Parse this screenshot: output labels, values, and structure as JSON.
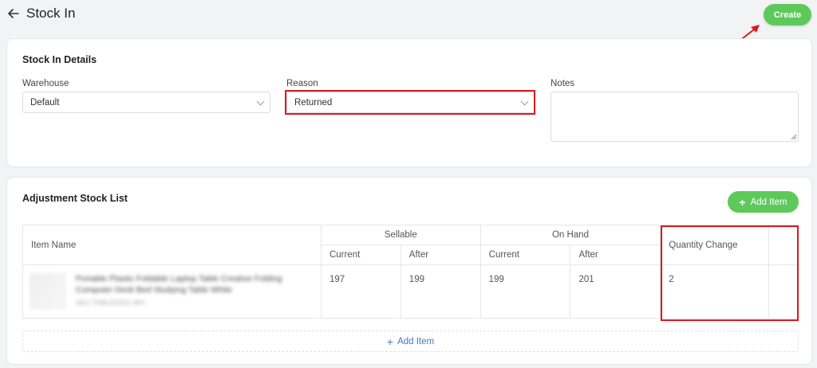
{
  "header": {
    "back_icon": "arrow-left-icon",
    "title": "Stock In",
    "create_label": "Create"
  },
  "details": {
    "title": "Stock In Details",
    "warehouse": {
      "label": "Warehouse",
      "value": "Default"
    },
    "reason": {
      "label": "Reason",
      "value": "Returned"
    },
    "notes": {
      "label": "Notes",
      "value": ""
    }
  },
  "adjustment": {
    "title": "Adjustment Stock List",
    "add_item_label": "Add Item",
    "columns": {
      "item_name": "Item Name",
      "sellable": "Sellable",
      "on_hand": "On Hand",
      "current": "Current",
      "after": "After",
      "quantity_change": "Quantity Change"
    },
    "rows": [
      {
        "product_name": "Portable Plastic Foldable Laptop Table Creative Folding Computer Desk Bed Studying Table White",
        "product_sku": "SKU TABLE0001-WH",
        "sellable_current": "197",
        "sellable_after": "199",
        "onhand_current": "199",
        "onhand_after": "201",
        "quantity_change": "2"
      }
    ],
    "add_row_label": "Add Item"
  },
  "colors": {
    "accent_green": "#5ec95b",
    "highlight_red": "#e0161c",
    "link_blue": "#3a7bd5"
  }
}
